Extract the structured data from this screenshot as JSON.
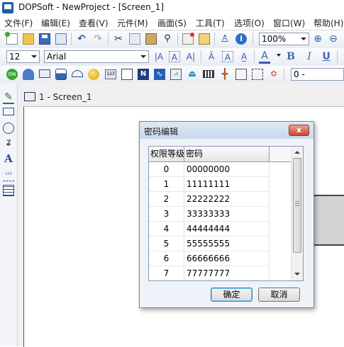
{
  "window": {
    "title": "DOPSoft - NewProject - [Screen_1]"
  },
  "menu": {
    "items": [
      "文件(F)",
      "编辑(E)",
      "查看(V)",
      "元件(M)",
      "画面(S)",
      "工具(T)",
      "选项(O)",
      "窗口(W)",
      "帮助(H)"
    ]
  },
  "toolbar1": {
    "zoom_value": "100%"
  },
  "toolbar2": {
    "font_size": "12",
    "font_name": "Arial"
  },
  "toolbar3": {
    "layer_value": "0 -"
  },
  "document": {
    "tab_title": "1 - Screen_1"
  },
  "dialog": {
    "title": "密码编辑",
    "close_label": "x",
    "columns": [
      "权限等级",
      "密码"
    ],
    "rows": [
      {
        "level": "0",
        "password": "00000000"
      },
      {
        "level": "1",
        "password": "11111111"
      },
      {
        "level": "2",
        "password": "22222222"
      },
      {
        "level": "3",
        "password": "33333333"
      },
      {
        "level": "4",
        "password": "44444444"
      },
      {
        "level": "5",
        "password": "55555555"
      },
      {
        "level": "6",
        "password": "66666666"
      },
      {
        "level": "7",
        "password": "77777777"
      }
    ],
    "ok_label": "确定",
    "cancel_label": "取消"
  },
  "colors": {
    "title_accent": "#1f5fa8",
    "dialog_bg": "#eef3f9",
    "close_red": "#c7462a"
  }
}
